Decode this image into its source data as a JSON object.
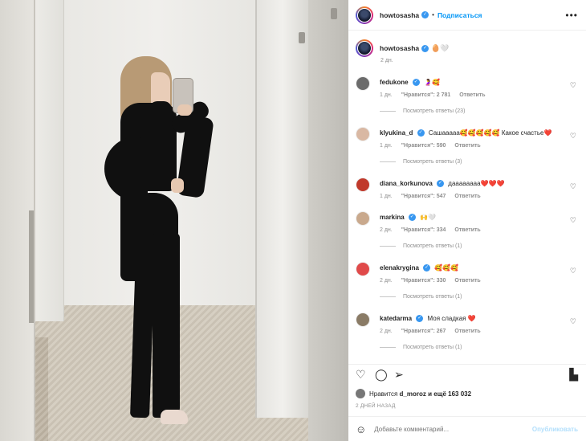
{
  "post": {
    "username": "howtosasha",
    "follow_label": "Подписаться",
    "more_icon": "more-horizontal-icon",
    "caption_emoji": "🥚🤍",
    "caption_time": "2 дн.",
    "liked_by_prefix": "Нравится",
    "liked_by_user": "d_moroz",
    "liked_by_suffix": "и ещё 163 032",
    "date": "2 ДНЕЙ НАЗАД",
    "add_comment_placeholder": "Добавьте комментарий...",
    "publish_label": "Опубликовать"
  },
  "comments": [
    {
      "user": "fedukone",
      "text": "🤰🥰",
      "time": "1 дн.",
      "likes": "\"Нравится\": 2 781",
      "reply": "Ответить",
      "replies": "Посмотреть ответы (23)",
      "avatar_color": "#6b6b6b"
    },
    {
      "user": "klyukina_d",
      "text": "Сашааааа🥰🥰🥰🥰🥰 Какое счастье❤️",
      "time": "1 дн.",
      "likes": "\"Нравится\": 590",
      "reply": "Ответить",
      "replies": "Посмотреть ответы (3)",
      "avatar_color": "#d9b8a3"
    },
    {
      "user": "diana_korkunova",
      "text": "даааааааа❤️❤️❤️",
      "time": "1 дн.",
      "likes": "\"Нравится\": 547",
      "reply": "Ответить",
      "replies": "",
      "avatar_color": "#c0392b"
    },
    {
      "user": "markina",
      "text": "🙌🤍",
      "time": "2 дн.",
      "likes": "\"Нравится\": 334",
      "reply": "Ответить",
      "replies": "Посмотреть ответы (1)",
      "avatar_color": "#c9a98d"
    },
    {
      "user": "elenakrygina",
      "text": "🥰🥰🥰",
      "time": "2 дн.",
      "likes": "\"Нравится\": 330",
      "reply": "Ответить",
      "replies": "Посмотреть ответы (1)",
      "avatar_color": "#e04a4a"
    },
    {
      "user": "katedarma",
      "text": "Моя сладкая ❤️",
      "time": "2 дн.",
      "likes": "\"Нравится\": 267",
      "reply": "Ответить",
      "replies": "Посмотреть ответы (1)",
      "avatar_color": "#8a7b66"
    }
  ],
  "icons": {
    "like": "heart-icon",
    "comment": "comment-icon",
    "share": "share-icon",
    "save": "bookmark-icon",
    "emoji": "emoji-icon"
  },
  "colors": {
    "link": "#0095f6",
    "verified": "#3897f0",
    "muted": "#8e8e8e",
    "publish_disabled": "#b2dffc"
  }
}
